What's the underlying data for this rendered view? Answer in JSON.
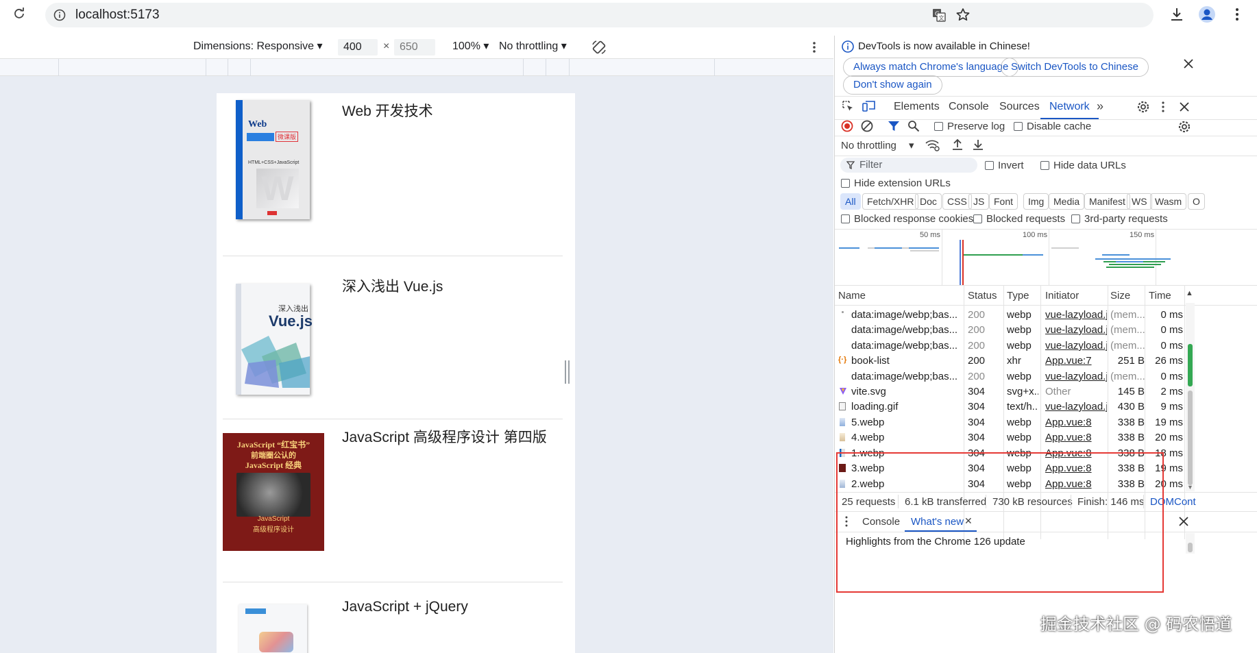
{
  "browser": {
    "url": "localhost:5173"
  },
  "device_toolbar": {
    "dimensions_label": "Dimensions: Responsive",
    "width_value": "400",
    "times": "×",
    "height_value": "650",
    "zoom": "100%",
    "throttling": "No throttling"
  },
  "books": [
    {
      "title": "Web 开发技术"
    },
    {
      "title": "深入浅出 Vue.js"
    },
    {
      "title": "JavaScript 高级程序设计 第四版"
    },
    {
      "title": "JavaScript + jQuery"
    }
  ],
  "covers": {
    "web": {
      "top_text": "Web",
      "badge": "微课版",
      "sub": "HTML+CSS+JavaScript"
    },
    "vue": {
      "line1": "深入浅出",
      "line2": "Vue.js"
    },
    "js": {
      "line1": "JavaScript “红宝书”",
      "line2": "前端圈公认的",
      "line3": "JavaScript 经典",
      "line4": "JavaScript",
      "line5": "高级程序设计"
    }
  },
  "devtools": {
    "banner": {
      "message": "DevTools is now available in Chinese!",
      "btn_match": "Always match Chrome's language",
      "btn_switch": "Switch DevTools to Chinese",
      "btn_dont_show": "Don't show again"
    },
    "tabs": [
      "Elements",
      "Console",
      "Sources",
      "Network"
    ],
    "active_tab": "Network",
    "controls": {
      "preserve_log": "Preserve log",
      "disable_cache": "Disable cache",
      "throttling": "No throttling",
      "filter_placeholder": "Filter",
      "invert": "Invert",
      "hide_data_urls": "Hide data URLs",
      "hide_extension_urls": "Hide extension URLs",
      "blocked_cookies": "Blocked response cookies",
      "blocked_requests": "Blocked requests",
      "third_party": "3rd-party requests"
    },
    "type_filters": [
      "All",
      "Fetch/XHR",
      "Doc",
      "CSS",
      "JS",
      "Font",
      "Img",
      "Media",
      "Manifest",
      "WS",
      "Wasm",
      "O"
    ],
    "overview_ticks": [
      "50 ms",
      "100 ms",
      "150 ms"
    ],
    "columns": {
      "name": "Name",
      "status": "Status",
      "type": "Type",
      "initiator": "Initiator",
      "size": "Size",
      "time": "Time"
    },
    "rows": [
      {
        "name": "data:image/webp;bas...",
        "status": "200",
        "type": "webp",
        "initiator": "vue-lazyload.js",
        "size": "(mem...",
        "time": "0 ms",
        "cached": true,
        "icon": "dot"
      },
      {
        "name": "data:image/webp;bas...",
        "status": "200",
        "type": "webp",
        "initiator": "vue-lazyload.js",
        "size": "(mem...",
        "time": "0 ms",
        "cached": true,
        "icon": "none"
      },
      {
        "name": "data:image/webp;bas...",
        "status": "200",
        "type": "webp",
        "initiator": "vue-lazyload.js",
        "size": "(mem...",
        "time": "0 ms",
        "cached": true,
        "icon": "none"
      },
      {
        "name": "book-list",
        "status": "200",
        "type": "xhr",
        "initiator": "App.vue:7",
        "size": "251 B",
        "time": "26 ms",
        "cached": false,
        "icon": "xhr"
      },
      {
        "name": "data:image/webp;bas...",
        "status": "200",
        "type": "webp",
        "initiator": "vue-lazyload.js",
        "size": "(mem...",
        "time": "0 ms",
        "cached": true,
        "icon": "none"
      },
      {
        "name": "vite.svg",
        "status": "304",
        "type": "svg+x...",
        "initiator": "Other",
        "size": "145 B",
        "time": "2 ms",
        "cached": false,
        "icon": "vite"
      },
      {
        "name": "loading.gif",
        "status": "304",
        "type": "text/h...",
        "initiator": "vue-lazyload.js",
        "size": "430 B",
        "time": "9 ms",
        "cached": false,
        "icon": "doc"
      },
      {
        "name": "5.webp",
        "status": "304",
        "type": "webp",
        "initiator": "App.vue:8",
        "size": "338 B",
        "time": "19 ms",
        "cached": false,
        "icon": "img"
      },
      {
        "name": "4.webp",
        "status": "304",
        "type": "webp",
        "initiator": "App.vue:8",
        "size": "338 B",
        "time": "20 ms",
        "cached": false,
        "icon": "img"
      },
      {
        "name": "1.webp",
        "status": "304",
        "type": "webp",
        "initiator": "App.vue:8",
        "size": "338 B",
        "time": "18 ms",
        "cached": false,
        "icon": "img"
      },
      {
        "name": "3.webp",
        "status": "304",
        "type": "webp",
        "initiator": "App.vue:8",
        "size": "338 B",
        "time": "19 ms",
        "cached": false,
        "icon": "imgdark"
      },
      {
        "name": "2.webp",
        "status": "304",
        "type": "webp",
        "initiator": "App.vue:8",
        "size": "338 B",
        "time": "20 ms",
        "cached": false,
        "icon": "img"
      }
    ],
    "status_bar": {
      "requests": "25 requests",
      "transferred": "6.1 kB transferred",
      "resources": "730 kB resources",
      "finish": "Finish: 146 ms",
      "domcontent": "DOMCont"
    },
    "drawer": {
      "tabs": [
        "Console",
        "What's new"
      ],
      "active": "What's new",
      "highlight": "Highlights from the Chrome 126 update"
    }
  },
  "watermark": "掘金技术社区 @ 码农悟道",
  "colors": {
    "accent": "#1a56c4",
    "highlight_box": "#e53935",
    "record": "#d93025"
  }
}
